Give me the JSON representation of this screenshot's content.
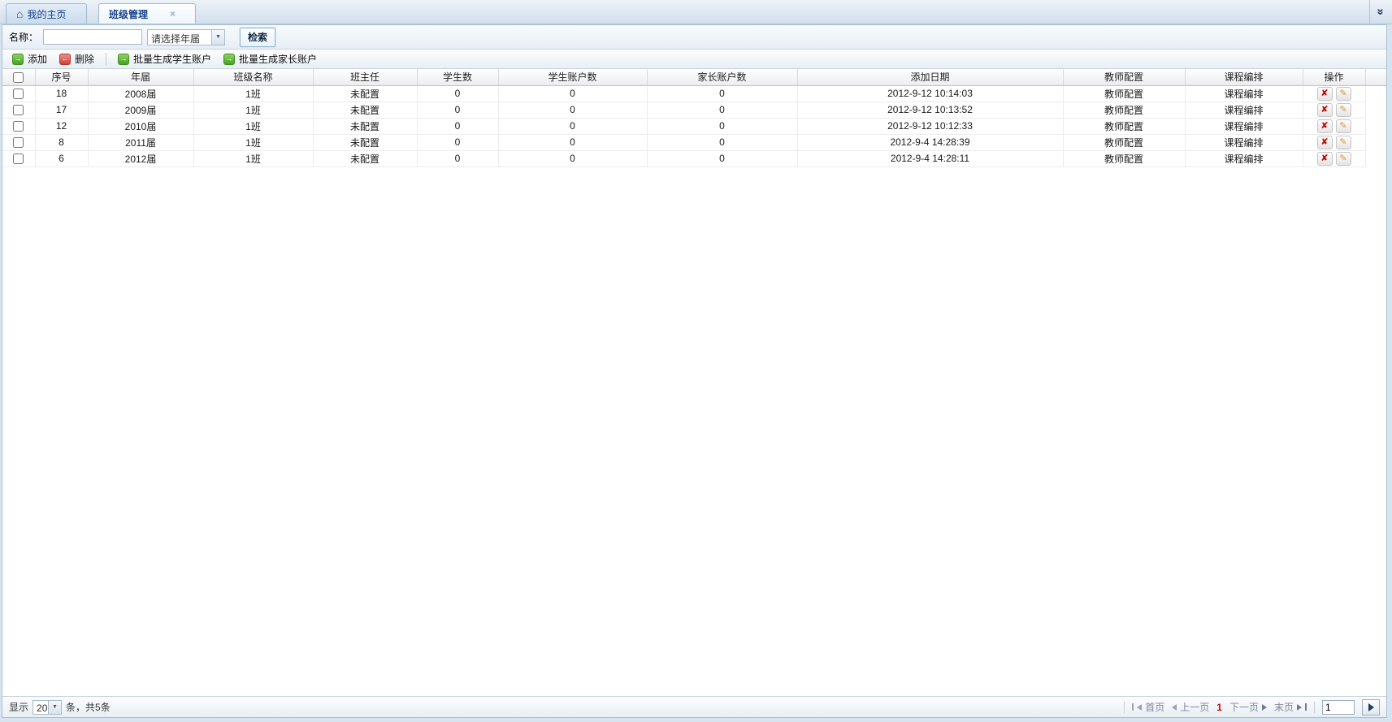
{
  "tabs": {
    "items": [
      {
        "label": "我的主页",
        "icon": "home",
        "active": false
      },
      {
        "label": "班级管理",
        "active": true,
        "closable": true
      }
    ]
  },
  "search": {
    "name_label": "名称：",
    "name_value": "",
    "year_combo_value": "请选择年届",
    "search_button": "检索"
  },
  "toolbar": {
    "add": "添加",
    "delete": "删除",
    "batch_student": "批量生成学生账户",
    "batch_parent": "批量生成家长账户"
  },
  "table": {
    "headers": [
      "序号",
      "年届",
      "班级名称",
      "班主任",
      "学生数",
      "学生账户数",
      "家长账户数",
      "添加日期",
      "教师配置",
      "课程编排",
      "操作"
    ],
    "rows": [
      {
        "seq": "18",
        "year": "2008届",
        "class_name": "1班",
        "head_teacher": "未配置",
        "students": "0",
        "student_accounts": "0",
        "parent_accounts": "0",
        "added": "2012-9-12 10:14:03",
        "teacher_config": "教师配置",
        "course_schedule": "课程编排"
      },
      {
        "seq": "17",
        "year": "2009届",
        "class_name": "1班",
        "head_teacher": "未配置",
        "students": "0",
        "student_accounts": "0",
        "parent_accounts": "0",
        "added": "2012-9-12 10:13:52",
        "teacher_config": "教师配置",
        "course_schedule": "课程编排"
      },
      {
        "seq": "12",
        "year": "2010届",
        "class_name": "1班",
        "head_teacher": "未配置",
        "students": "0",
        "student_accounts": "0",
        "parent_accounts": "0",
        "added": "2012-9-12 10:12:33",
        "teacher_config": "教师配置",
        "course_schedule": "课程编排"
      },
      {
        "seq": "8",
        "year": "2011届",
        "class_name": "1班",
        "head_teacher": "未配置",
        "students": "0",
        "student_accounts": "0",
        "parent_accounts": "0",
        "added": "2012-9-4 14:28:39",
        "teacher_config": "教师配置",
        "course_schedule": "课程编排"
      },
      {
        "seq": "6",
        "year": "2012届",
        "class_name": "1班",
        "head_teacher": "未配置",
        "students": "0",
        "student_accounts": "0",
        "parent_accounts": "0",
        "added": "2012-9-4 14:28:11",
        "teacher_config": "教师配置",
        "course_schedule": "课程编排"
      }
    ]
  },
  "pager": {
    "display_label": "显示",
    "page_size": "20",
    "suffix": "条，共5条",
    "first": "首页",
    "prev": "上一页",
    "current": "1",
    "next": "下一页",
    "last": "末页",
    "page_input": "1"
  },
  "colors": {
    "accent": "#15428b",
    "current_page": "#d40000",
    "add_icon_green": "#46a321",
    "delete_icon_red": "#c94239",
    "action_x_red": "#c00000",
    "pencil_gold": "#cf9b30"
  }
}
